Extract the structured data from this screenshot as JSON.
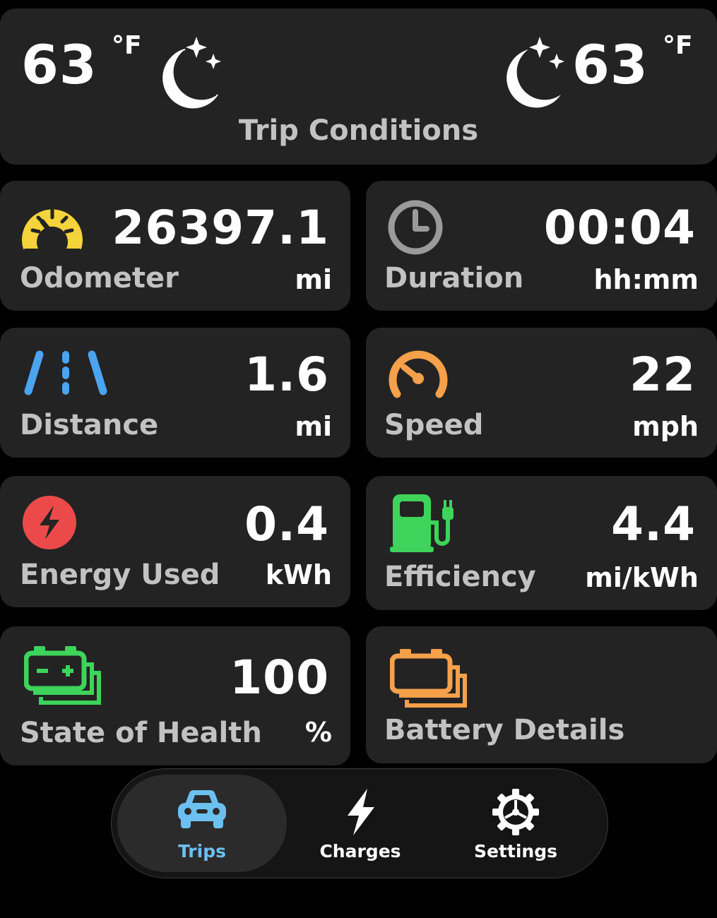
{
  "conditions": {
    "start_temp": "63",
    "start_unit": "°F",
    "start_icon": "moon-stars-icon",
    "end_temp": "63",
    "end_unit": "°F",
    "end_icon": "moon-stars-icon",
    "title": "Trip Conditions"
  },
  "stats": {
    "odometer": {
      "value": "26397.1",
      "label": "Odometer",
      "unit": "mi",
      "icon": "speedometer-icon",
      "color": "#f5d33a"
    },
    "duration": {
      "value": "00:04",
      "label": "Duration",
      "unit": "hh:mm",
      "icon": "clock-icon",
      "color": "#9a9a9a"
    },
    "distance": {
      "value": "1.6",
      "label": "Distance",
      "unit": "mi",
      "icon": "road-lanes-icon",
      "color": "#4aa4f0"
    },
    "speed": {
      "value": "22",
      "label": "Speed",
      "unit": "mph",
      "icon": "gauge-icon",
      "color": "#f5a04a"
    },
    "energy": {
      "value": "0.4",
      "label": "Energy Used",
      "unit": "kWh",
      "icon": "bolt-circle-icon",
      "color": "#ec4a4a"
    },
    "efficiency": {
      "value": "4.4",
      "label": "Efficiency",
      "unit": "mi/kWh",
      "icon": "ev-charger-icon",
      "color": "#3ed35a"
    },
    "health": {
      "value": "100",
      "label": "State of Health",
      "unit": "%",
      "icon": "battery-stack-icon",
      "color": "#3ed35a"
    },
    "battery": {
      "label": "Battery Details",
      "icon": "battery-stack-icon",
      "color": "#f5a04a"
    }
  },
  "tabs": [
    {
      "label": "Trips",
      "icon": "car-icon",
      "active": true,
      "color": "#6cc0f0"
    },
    {
      "label": "Charges",
      "icon": "bolt-icon",
      "active": false,
      "color": "#ffffff"
    },
    {
      "label": "Settings",
      "icon": "gear-icon",
      "active": false,
      "color": "#ffffff"
    }
  ]
}
